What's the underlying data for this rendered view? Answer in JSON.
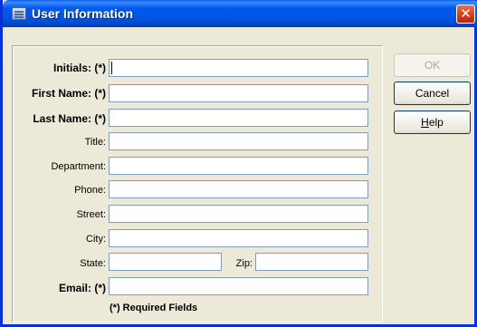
{
  "window": {
    "title": "User Information",
    "close_glyph": "✕"
  },
  "form": {
    "initials": {
      "label": "Initials: (*)",
      "value": ""
    },
    "first_name": {
      "label": "First Name: (*)",
      "value": ""
    },
    "last_name": {
      "label": "Last Name: (*)",
      "value": ""
    },
    "title": {
      "label": "Title:",
      "value": ""
    },
    "department": {
      "label": "Department:",
      "value": ""
    },
    "phone": {
      "label": "Phone:",
      "value": ""
    },
    "street": {
      "label": "Street:",
      "value": ""
    },
    "city": {
      "label": "City:",
      "value": ""
    },
    "state": {
      "label": "State:",
      "value": ""
    },
    "zip": {
      "label": "Zip:",
      "value": ""
    },
    "email": {
      "label": "Email: (*)",
      "value": ""
    },
    "required_note": "(*) Required Fields"
  },
  "buttons": {
    "ok": "OK",
    "cancel": "Cancel",
    "help_mnemonic": "H",
    "help_rest": "elp"
  },
  "colors": {
    "titlebar": "#0054E3",
    "background": "#ECE9D8",
    "field_border": "#7F9DB9"
  }
}
